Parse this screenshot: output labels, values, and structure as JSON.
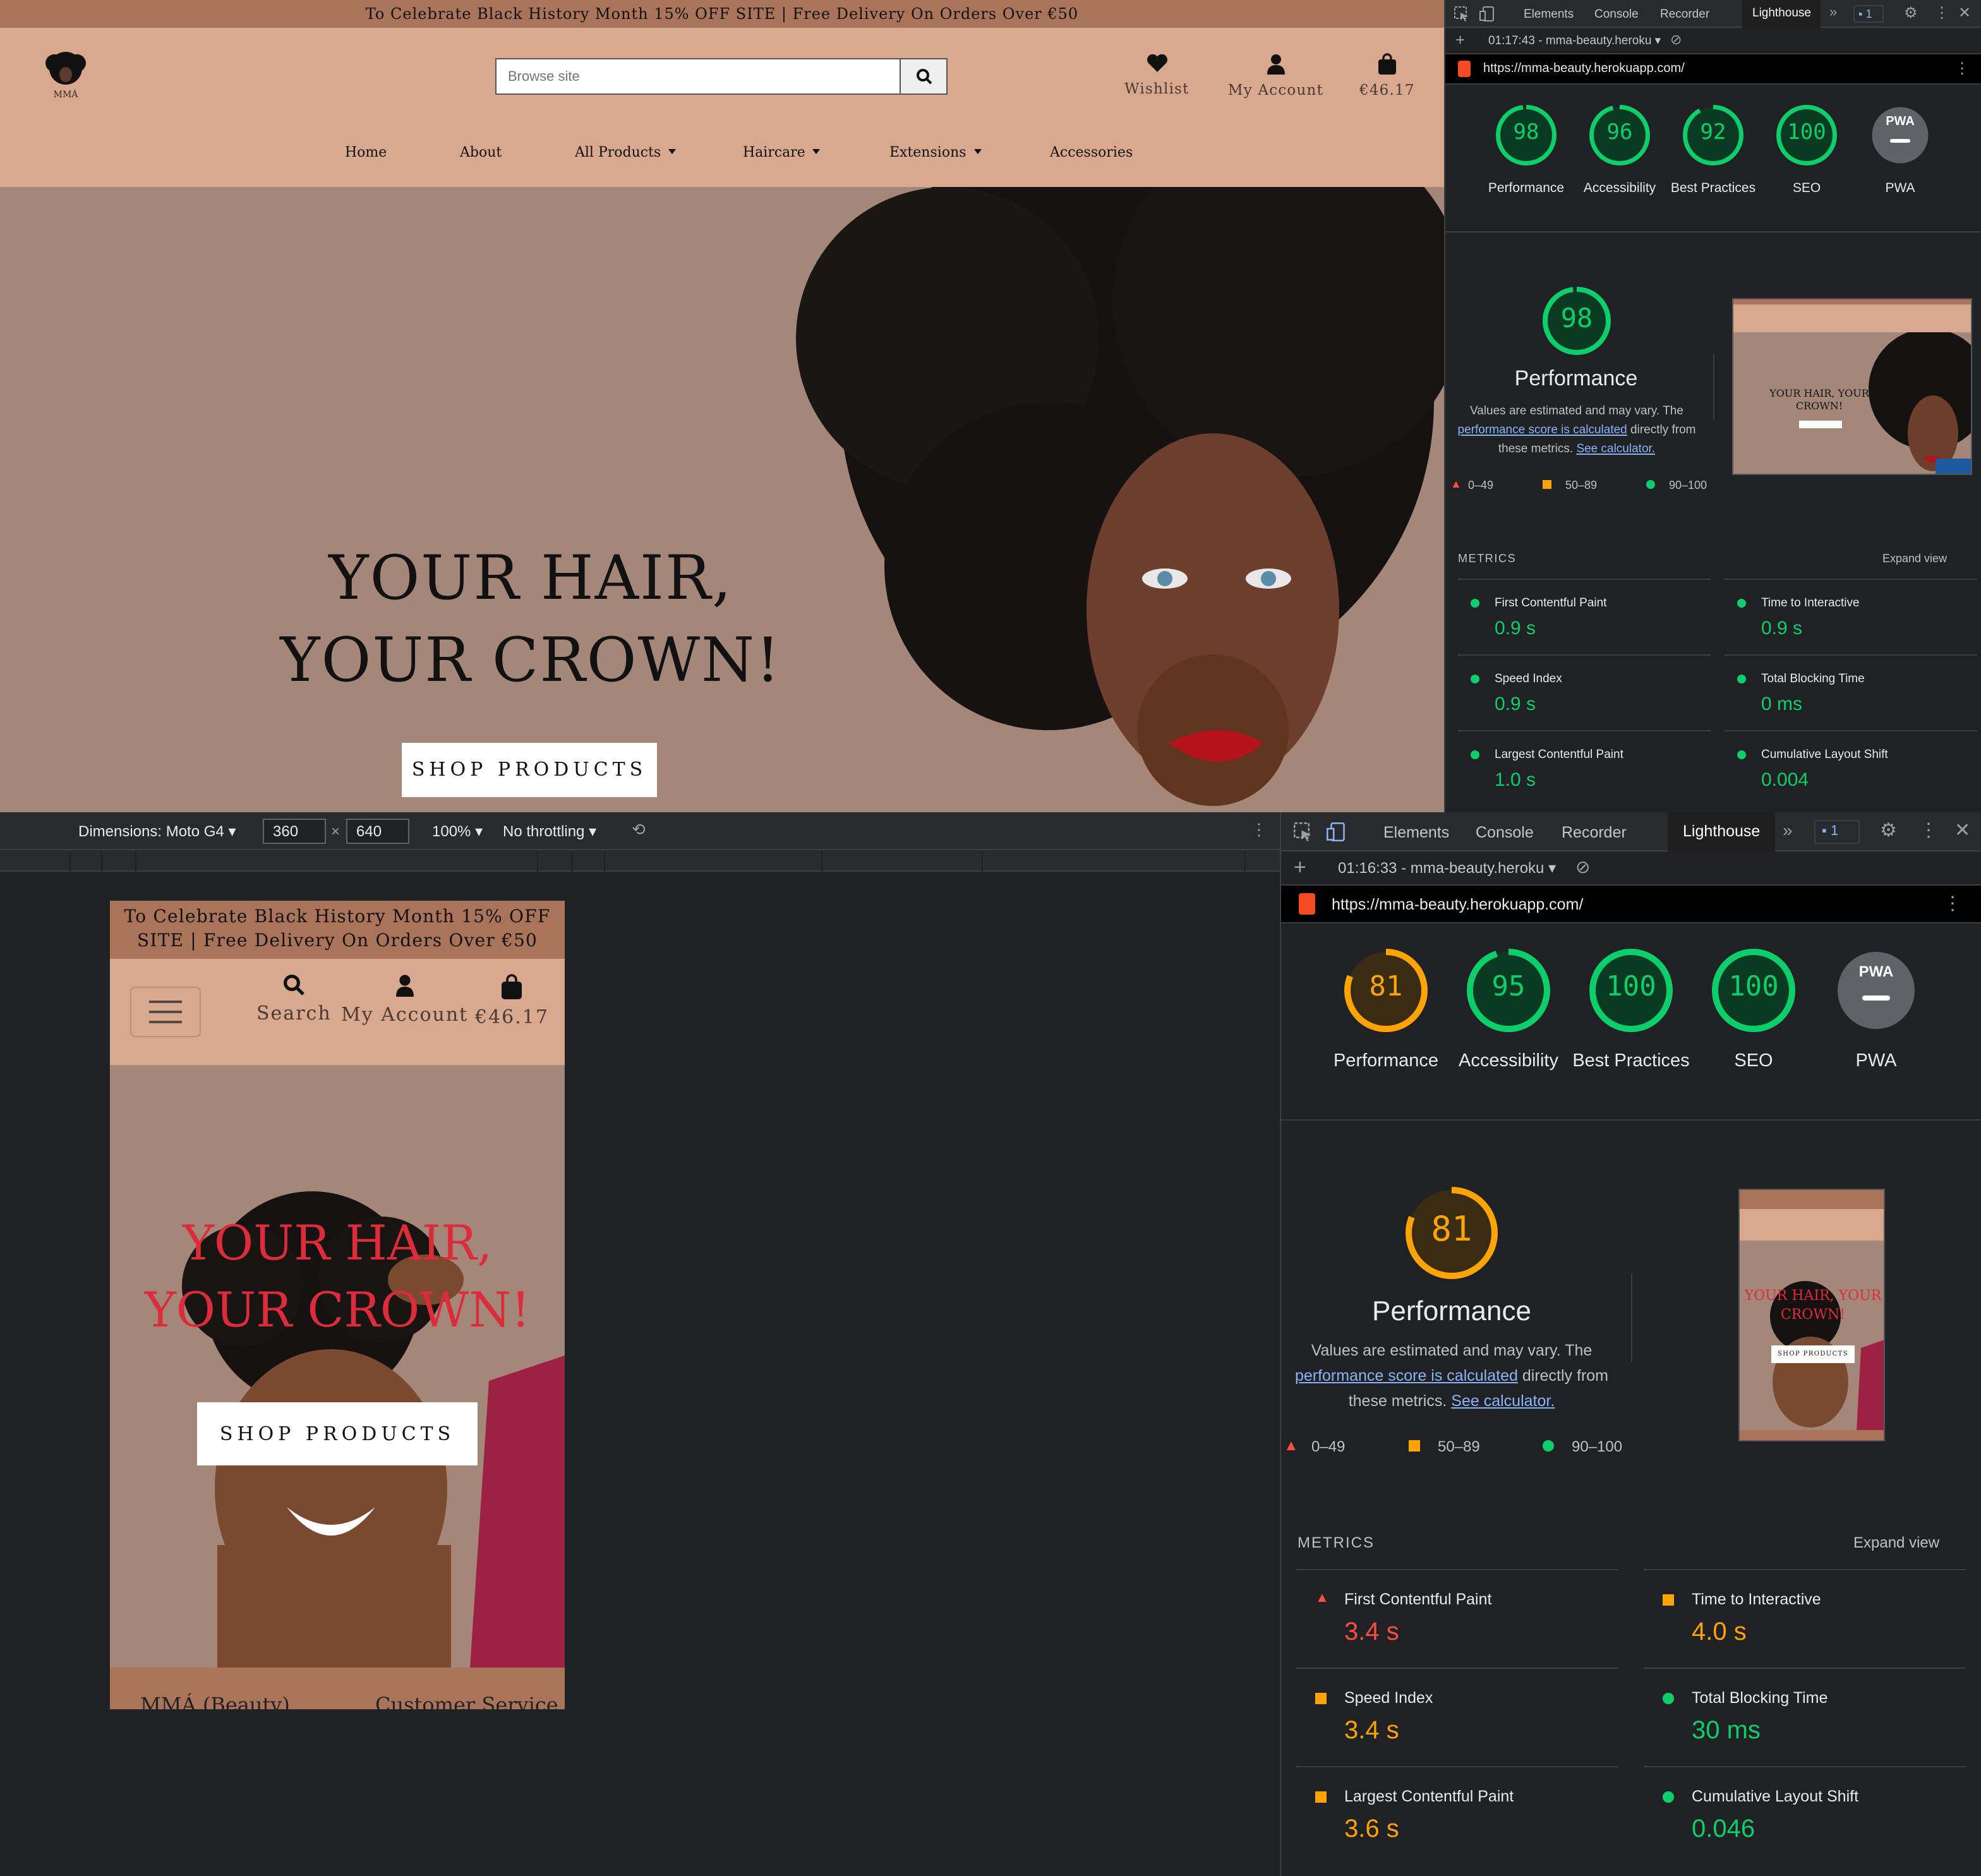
{
  "desktop_site": {
    "banner": "To Celebrate Black History Month 15% OFF SITE | Free Delivery On Orders Over €50",
    "logo_text": "MMÁ",
    "search": {
      "placeholder": "Browse site"
    },
    "header_links": {
      "wishlist": "Wishlist",
      "account": "My Account",
      "bag": "€46.17"
    },
    "nav": [
      "Home",
      "About",
      "All Products",
      "Haircare",
      "Extensions",
      "Accessories"
    ],
    "hero": {
      "line1": "YOUR HAIR,",
      "line2": "YOUR CROWN!",
      "cta": "SHOP PRODUCTS"
    }
  },
  "devtools_top": {
    "tabs": [
      "Elements",
      "Console",
      "Recorder",
      "Lighthouse"
    ],
    "messages_badge": "1",
    "report_selector": "01:17:43 - mma-beauty.heroku",
    "url": "https://mma-beauty.herokuapp.com/",
    "scores": [
      {
        "label": "Performance",
        "value": "98",
        "fraction": 0.98,
        "status": "green"
      },
      {
        "label": "Accessibility",
        "value": "96",
        "fraction": 0.96,
        "status": "green"
      },
      {
        "label": "Best Practices",
        "value": "92",
        "fraction": 0.92,
        "status": "green"
      },
      {
        "label": "SEO",
        "value": "100",
        "fraction": 1.0,
        "status": "green"
      },
      {
        "label": "PWA",
        "value": "PWA",
        "fraction": 0,
        "status": "grey"
      }
    ],
    "perf": {
      "score": "98",
      "title": "Performance",
      "desc_prefix": "Values are estimated and may vary. The",
      "desc_link": "performance score is calculated",
      "desc_mid": "directly from these metrics.",
      "desc_link2": "See calculator.",
      "legend": [
        "0–49",
        "50–89",
        "90–100"
      ],
      "thumb_text": "YOUR HAIR, YOUR CROWN!"
    },
    "metrics_heading": "METRICS",
    "expand": "Expand view",
    "metrics": [
      {
        "name": "First Contentful Paint",
        "value": "0.9 s",
        "status": "green"
      },
      {
        "name": "Time to Interactive",
        "value": "0.9 s",
        "status": "green"
      },
      {
        "name": "Speed Index",
        "value": "0.9 s",
        "status": "green"
      },
      {
        "name": "Total Blocking Time",
        "value": "0 ms",
        "status": "green"
      },
      {
        "name": "Largest Contentful Paint",
        "value": "1.0 s",
        "status": "green"
      },
      {
        "name": "Cumulative Layout Shift",
        "value": "0.004",
        "status": "green"
      }
    ]
  },
  "emulation": {
    "device": "Dimensions: Moto G4",
    "width": "360",
    "times": "×",
    "height": "640",
    "zoom": "100%",
    "throttle": "No throttling"
  },
  "mobile_site": {
    "banner": "To Celebrate Black History Month 15% OFF SITE | Free Delivery On Orders Over €50",
    "header_links": {
      "search": "Search",
      "account": "My Account",
      "bag": "€46.17"
    },
    "hero": {
      "line1": "YOUR HAIR,",
      "line2": "YOUR CROWN!",
      "cta": "SHOP PRODUCTS"
    },
    "footer": {
      "left": "MMÁ (Beauty)",
      "right": "Customer Service"
    }
  },
  "devtools_bottom": {
    "tabs": [
      "Elements",
      "Console",
      "Recorder",
      "Lighthouse"
    ],
    "messages_badge": "1",
    "report_selector": "01:16:33 - mma-beauty.heroku",
    "url": "https://mma-beauty.herokuapp.com/",
    "scores": [
      {
        "label": "Performance",
        "value": "81",
        "fraction": 0.81,
        "status": "orange"
      },
      {
        "label": "Accessibility",
        "value": "95",
        "fraction": 0.95,
        "status": "green"
      },
      {
        "label": "Best Practices",
        "value": "100",
        "fraction": 1.0,
        "status": "green"
      },
      {
        "label": "SEO",
        "value": "100",
        "fraction": 1.0,
        "status": "green"
      },
      {
        "label": "PWA",
        "value": "PWA",
        "fraction": 0,
        "status": "grey"
      }
    ],
    "perf": {
      "score": "81",
      "title": "Performance",
      "desc_prefix": "Values are estimated and may vary. The",
      "desc_link": "performance score is calculated",
      "desc_mid": "directly from these metrics.",
      "desc_link2": "See calculator.",
      "legend": [
        "0–49",
        "50–89",
        "90–100"
      ],
      "thumb_text": "YOUR HAIR, YOUR CROWN!",
      "thumb_cta": "SHOP PRODUCTS"
    },
    "metrics_heading": "METRICS",
    "expand": "Expand view",
    "metrics": [
      {
        "name": "First Contentful Paint",
        "value": "3.4 s",
        "status": "red"
      },
      {
        "name": "Time to Interactive",
        "value": "4.0 s",
        "status": "orange"
      },
      {
        "name": "Speed Index",
        "value": "3.4 s",
        "status": "orange"
      },
      {
        "name": "Total Blocking Time",
        "value": "30 ms",
        "status": "green"
      },
      {
        "name": "Largest Contentful Paint",
        "value": "3.6 s",
        "status": "orange"
      },
      {
        "name": "Cumulative Layout Shift",
        "value": "0.046",
        "status": "green"
      }
    ]
  },
  "colors": {
    "green": "#0cce6b",
    "orange": "#ffa400",
    "red": "#ff4e42",
    "brand_pink": "#d8a88f",
    "brand_brown": "#a9745a",
    "hero_bg": "#a5877a"
  }
}
